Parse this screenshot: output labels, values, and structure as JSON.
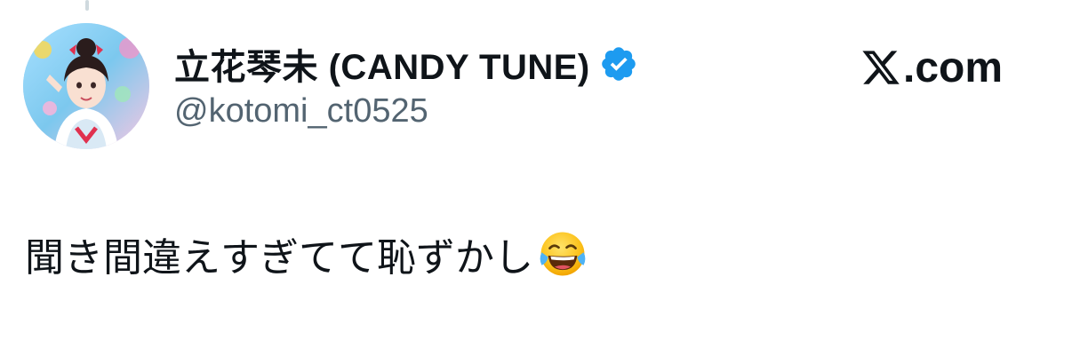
{
  "author": {
    "display_name": "立花琴未 (CANDY TUNE)",
    "handle": "@kotomi_ct0525",
    "verified": true,
    "avatar_icon": "profile-photo-avatar"
  },
  "brand": {
    "label": ".com",
    "logo_icon": "x-logo-icon"
  },
  "tweet": {
    "text": "聞き間違えすぎてて恥ずかし",
    "emoji_icon": "face-with-tears-of-joy-emoji"
  },
  "colors": {
    "text_primary": "#0f1419",
    "text_secondary": "#536471",
    "verified_blue": "#1d9bf0",
    "background": "#ffffff"
  }
}
